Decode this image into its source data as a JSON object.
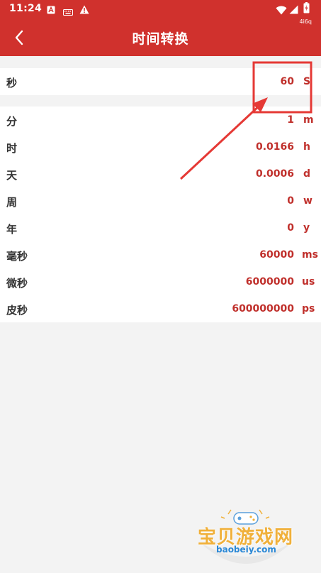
{
  "status_bar": {
    "time": "11:24",
    "net_speed": "4i6q"
  },
  "app_bar": {
    "title": "时间转换"
  },
  "input_row": {
    "label": "秒",
    "value": "60",
    "unit": "S"
  },
  "rows": [
    {
      "label": "分",
      "value": "1",
      "unit": "m"
    },
    {
      "label": "时",
      "value": "0.0166",
      "unit": "h"
    },
    {
      "label": "天",
      "value": "0.0006",
      "unit": "d"
    },
    {
      "label": "周",
      "value": "0",
      "unit": "w"
    },
    {
      "label": "年",
      "value": "0",
      "unit": "y"
    },
    {
      "label": "毫秒",
      "value": "60000",
      "unit": "ms"
    },
    {
      "label": "微秒",
      "value": "6000000",
      "unit": "us"
    },
    {
      "label": "皮秒",
      "value": "600000000",
      "unit": "ps"
    }
  ],
  "watermark": {
    "title": "宝贝游戏网",
    "url": "baobeiy.com"
  },
  "colors": {
    "accent": "#d0312d",
    "value_text": "#c0302c",
    "background": "#f3f3f3"
  }
}
